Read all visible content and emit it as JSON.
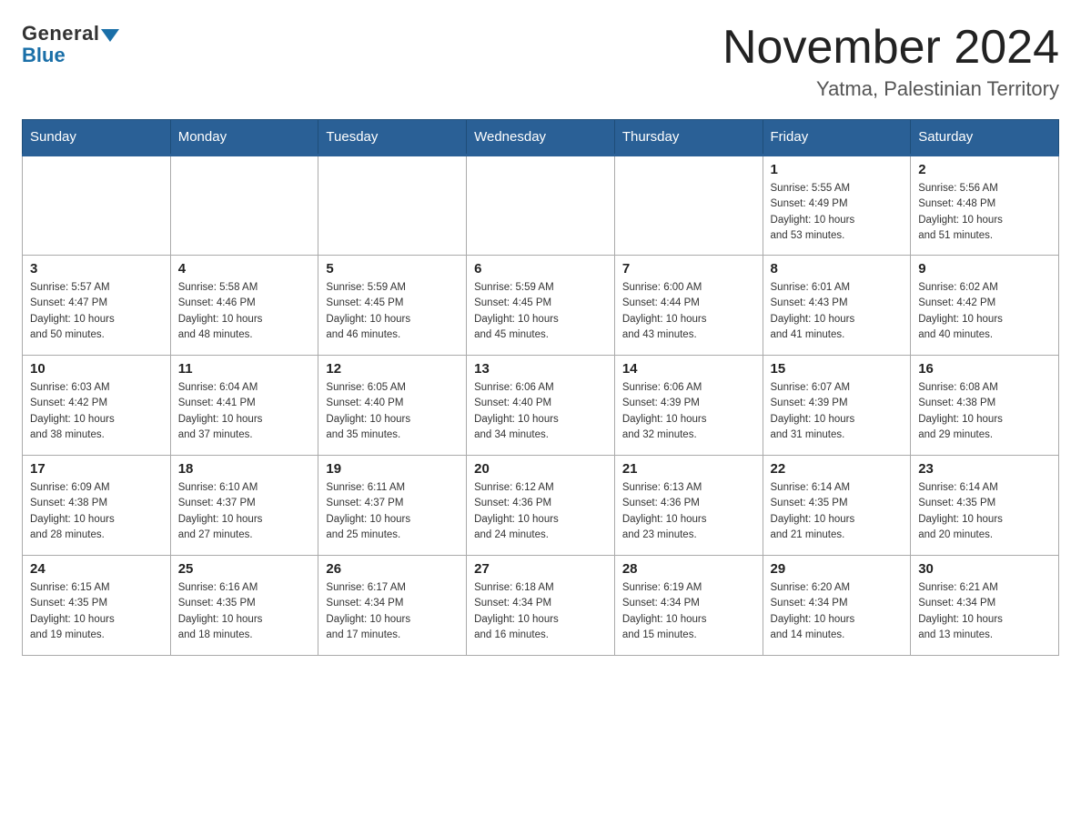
{
  "header": {
    "logo_general": "General",
    "logo_blue": "Blue",
    "month_title": "November 2024",
    "location": "Yatma, Palestinian Territory"
  },
  "weekdays": [
    "Sunday",
    "Monday",
    "Tuesday",
    "Wednesday",
    "Thursday",
    "Friday",
    "Saturday"
  ],
  "weeks": [
    [
      {
        "day": "",
        "info": ""
      },
      {
        "day": "",
        "info": ""
      },
      {
        "day": "",
        "info": ""
      },
      {
        "day": "",
        "info": ""
      },
      {
        "day": "",
        "info": ""
      },
      {
        "day": "1",
        "info": "Sunrise: 5:55 AM\nSunset: 4:49 PM\nDaylight: 10 hours\nand 53 minutes."
      },
      {
        "day": "2",
        "info": "Sunrise: 5:56 AM\nSunset: 4:48 PM\nDaylight: 10 hours\nand 51 minutes."
      }
    ],
    [
      {
        "day": "3",
        "info": "Sunrise: 5:57 AM\nSunset: 4:47 PM\nDaylight: 10 hours\nand 50 minutes."
      },
      {
        "day": "4",
        "info": "Sunrise: 5:58 AM\nSunset: 4:46 PM\nDaylight: 10 hours\nand 48 minutes."
      },
      {
        "day": "5",
        "info": "Sunrise: 5:59 AM\nSunset: 4:45 PM\nDaylight: 10 hours\nand 46 minutes."
      },
      {
        "day": "6",
        "info": "Sunrise: 5:59 AM\nSunset: 4:45 PM\nDaylight: 10 hours\nand 45 minutes."
      },
      {
        "day": "7",
        "info": "Sunrise: 6:00 AM\nSunset: 4:44 PM\nDaylight: 10 hours\nand 43 minutes."
      },
      {
        "day": "8",
        "info": "Sunrise: 6:01 AM\nSunset: 4:43 PM\nDaylight: 10 hours\nand 41 minutes."
      },
      {
        "day": "9",
        "info": "Sunrise: 6:02 AM\nSunset: 4:42 PM\nDaylight: 10 hours\nand 40 minutes."
      }
    ],
    [
      {
        "day": "10",
        "info": "Sunrise: 6:03 AM\nSunset: 4:42 PM\nDaylight: 10 hours\nand 38 minutes."
      },
      {
        "day": "11",
        "info": "Sunrise: 6:04 AM\nSunset: 4:41 PM\nDaylight: 10 hours\nand 37 minutes."
      },
      {
        "day": "12",
        "info": "Sunrise: 6:05 AM\nSunset: 4:40 PM\nDaylight: 10 hours\nand 35 minutes."
      },
      {
        "day": "13",
        "info": "Sunrise: 6:06 AM\nSunset: 4:40 PM\nDaylight: 10 hours\nand 34 minutes."
      },
      {
        "day": "14",
        "info": "Sunrise: 6:06 AM\nSunset: 4:39 PM\nDaylight: 10 hours\nand 32 minutes."
      },
      {
        "day": "15",
        "info": "Sunrise: 6:07 AM\nSunset: 4:39 PM\nDaylight: 10 hours\nand 31 minutes."
      },
      {
        "day": "16",
        "info": "Sunrise: 6:08 AM\nSunset: 4:38 PM\nDaylight: 10 hours\nand 29 minutes."
      }
    ],
    [
      {
        "day": "17",
        "info": "Sunrise: 6:09 AM\nSunset: 4:38 PM\nDaylight: 10 hours\nand 28 minutes."
      },
      {
        "day": "18",
        "info": "Sunrise: 6:10 AM\nSunset: 4:37 PM\nDaylight: 10 hours\nand 27 minutes."
      },
      {
        "day": "19",
        "info": "Sunrise: 6:11 AM\nSunset: 4:37 PM\nDaylight: 10 hours\nand 25 minutes."
      },
      {
        "day": "20",
        "info": "Sunrise: 6:12 AM\nSunset: 4:36 PM\nDaylight: 10 hours\nand 24 minutes."
      },
      {
        "day": "21",
        "info": "Sunrise: 6:13 AM\nSunset: 4:36 PM\nDaylight: 10 hours\nand 23 minutes."
      },
      {
        "day": "22",
        "info": "Sunrise: 6:14 AM\nSunset: 4:35 PM\nDaylight: 10 hours\nand 21 minutes."
      },
      {
        "day": "23",
        "info": "Sunrise: 6:14 AM\nSunset: 4:35 PM\nDaylight: 10 hours\nand 20 minutes."
      }
    ],
    [
      {
        "day": "24",
        "info": "Sunrise: 6:15 AM\nSunset: 4:35 PM\nDaylight: 10 hours\nand 19 minutes."
      },
      {
        "day": "25",
        "info": "Sunrise: 6:16 AM\nSunset: 4:35 PM\nDaylight: 10 hours\nand 18 minutes."
      },
      {
        "day": "26",
        "info": "Sunrise: 6:17 AM\nSunset: 4:34 PM\nDaylight: 10 hours\nand 17 minutes."
      },
      {
        "day": "27",
        "info": "Sunrise: 6:18 AM\nSunset: 4:34 PM\nDaylight: 10 hours\nand 16 minutes."
      },
      {
        "day": "28",
        "info": "Sunrise: 6:19 AM\nSunset: 4:34 PM\nDaylight: 10 hours\nand 15 minutes."
      },
      {
        "day": "29",
        "info": "Sunrise: 6:20 AM\nSunset: 4:34 PM\nDaylight: 10 hours\nand 14 minutes."
      },
      {
        "day": "30",
        "info": "Sunrise: 6:21 AM\nSunset: 4:34 PM\nDaylight: 10 hours\nand 13 minutes."
      }
    ]
  ]
}
